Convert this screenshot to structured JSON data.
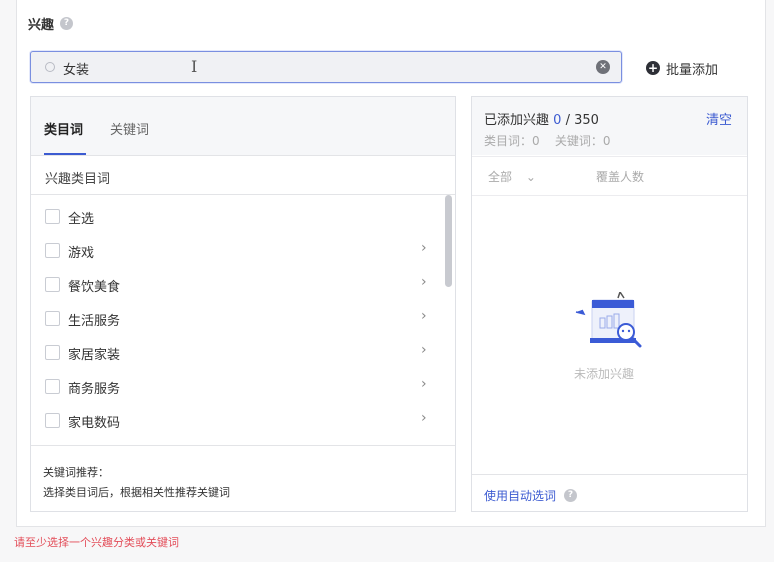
{
  "section": {
    "label": "兴趣"
  },
  "search": {
    "value": "女装",
    "placeholder": ""
  },
  "batch_add": {
    "label": "批量添加"
  },
  "left": {
    "tabs": [
      {
        "label": "类目词"
      },
      {
        "label": "关键词"
      }
    ],
    "category_header": "兴趣类目词",
    "items": [
      {
        "label": "全选",
        "has_children": false
      },
      {
        "label": "游戏",
        "has_children": true
      },
      {
        "label": "餐饮美食",
        "has_children": true
      },
      {
        "label": "生活服务",
        "has_children": true
      },
      {
        "label": "家居家装",
        "has_children": true
      },
      {
        "label": "商务服务",
        "has_children": true
      },
      {
        "label": "家电数码",
        "has_children": true
      }
    ],
    "tip_title": "关键词推荐：",
    "tip_body": "选择类目词后，根据相关性推荐关键词"
  },
  "right": {
    "added_prefix": "已添加兴趣",
    "added_count": "0",
    "added_sep": " / ",
    "added_max": "350",
    "clear": "清空",
    "sub": "类目词：0    关键词：0",
    "filter_value": "全部",
    "cover_label": "覆盖人数",
    "empty_text": "未添加兴趣",
    "auto_select": "使用自动选词"
  },
  "error": "请至少选择一个兴趣分类或关键词",
  "colors": {
    "accent": "#3c5bd1",
    "error": "#e34d59"
  }
}
